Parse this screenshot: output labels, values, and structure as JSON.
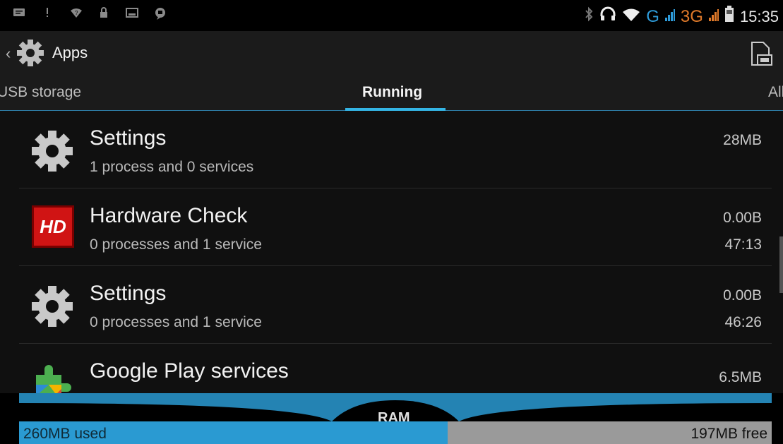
{
  "status_bar": {
    "left_icons": [
      "message-icon",
      "alert-icon",
      "wifi-question-icon",
      "lock-icon",
      "image-icon",
      "chat-icon"
    ],
    "network": "G",
    "network2": "3G",
    "time": "15:35"
  },
  "action_bar": {
    "title": "Apps"
  },
  "tabs": [
    {
      "label": "USB storage",
      "active": false
    },
    {
      "label": "Running",
      "active": true
    },
    {
      "label": "All",
      "active": false
    }
  ],
  "apps": [
    {
      "name": "Settings",
      "detail": "1 process and 0 services",
      "size": "28MB",
      "time": "",
      "icon": "gear-icon"
    },
    {
      "name": "Hardware Check",
      "detail": "0 processes and 1 service",
      "size": "0.00B",
      "time": "47:13",
      "icon": "hd-icon",
      "icon_text": "HD"
    },
    {
      "name": "Settings",
      "detail": "0 processes and 1 service",
      "size": "0.00B",
      "time": "46:26",
      "icon": "gear-icon"
    },
    {
      "name": "Google Play services",
      "detail": "",
      "size": "6.5MB",
      "time": "",
      "icon": "puzzle-icon"
    }
  ],
  "ram": {
    "label": "RAM",
    "used": "260MB used",
    "free": "197MB free",
    "used_fraction": 0.569
  },
  "colors": {
    "accent": "#34b5e5",
    "used_bar": "#2a9ad2",
    "free_bar": "#9a9a9a"
  }
}
